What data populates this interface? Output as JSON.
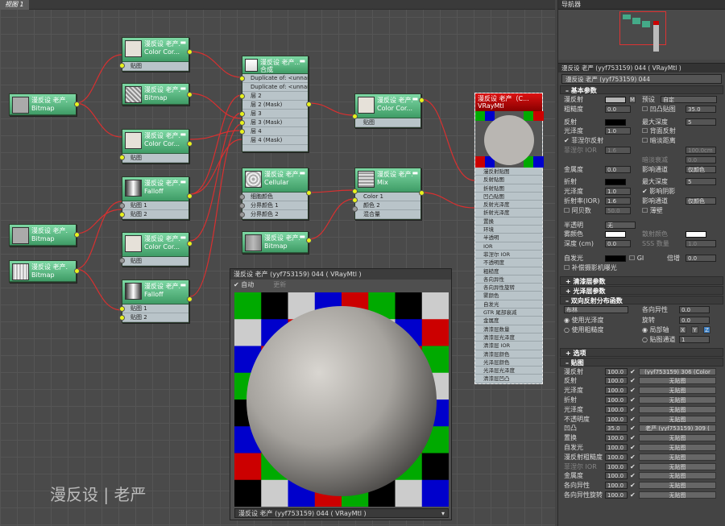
{
  "view_tab": "视图 1",
  "nodes": {
    "bitmap_a": {
      "title": "漫反设 老产...",
      "sub": "Bitmap"
    },
    "cc1": {
      "title": "漫反设 老产...",
      "sub": "Color Cor...",
      "row": "贴图"
    },
    "bmp2": {
      "title": "漫反设 老产...",
      "sub": "Bitmap"
    },
    "cc2": {
      "title": "漫反设 老产...",
      "sub": "Color Cor...",
      "row": "贴图"
    },
    "falloff1": {
      "title": "漫反设 老产...",
      "sub": "Falloff",
      "rows": [
        "贴图 1",
        "贴图 2"
      ]
    },
    "bitmap_b": {
      "title": "漫反设 老产...",
      "sub": "Bitmap"
    },
    "cc3": {
      "title": "漫反设 老产...",
      "sub": "Color Cor...",
      "row": "贴图"
    },
    "bitmap_c": {
      "title": "漫反设 老产...",
      "sub": "Bitmap"
    },
    "falloff2": {
      "title": "漫反设 老产...",
      "sub": "Falloff",
      "rows": [
        "贴图 1",
        "贴图 2"
      ]
    },
    "composite": {
      "title": "漫反设 老产...",
      "sub": "合成",
      "rows": [
        "Duplicate of: <unnamed l...",
        "Duplicate of: <unnamed l...",
        "层 2",
        "层 2 (Mask)",
        "层 3",
        "层 3 (Mask)",
        "层 4",
        "层 4 (Mask)"
      ]
    },
    "cc4": {
      "title": "漫反设 老产...",
      "sub": "Color Cor...",
      "row": "贴图"
    },
    "cellular": {
      "title": "漫反设 老产...",
      "sub": "Cellular",
      "rows": [
        "细胞颜色",
        "分界颜色 1",
        "分界颜色 2"
      ]
    },
    "bitmap_d": {
      "title": "漫反设 老产...",
      "sub": "Bitmap"
    },
    "mix": {
      "title": "漫反设 老产...",
      "sub": "Mix",
      "rows": [
        "Color 1",
        "颜色 2",
        "混合量"
      ]
    }
  },
  "vray": {
    "title": "漫反设 老产（C...",
    "sub": "VRayMtl",
    "rows": [
      "漫反射贴图",
      "反射贴图",
      "折射贴图",
      "凹凸贴图",
      "反射光泽度",
      "折射光泽度",
      "置换",
      "环境",
      "半透明",
      "IOR",
      "菲涅尔 IOR",
      "不透明度",
      "粗糙度",
      "各向异性",
      "各向异性旋转",
      "雾颜色",
      "自发光",
      "GTR 尾部衰减",
      "金属度",
      "清漆层数量",
      "清漆层光泽度",
      "清漆层 IOR",
      "清漆层颜色",
      "光泽层颜色",
      "光泽层光泽度",
      "清漆层凹凸"
    ]
  },
  "preview": {
    "title": "漫反设 老产 (yyf753159) 044 ( VRayMtl )",
    "auto": "自动",
    "update": "更新",
    "footer": "漫反设 老产 (yyf753159) 044   ( VRayMtl )"
  },
  "watermark": "漫反设 | 老严",
  "panel": {
    "nav_title": "导航器",
    "mat_title": "漫反设 老严 (yyf753159) 044 ( VRayMtl )",
    "mat_name": "漫反设 老严 (yyf753159) 044",
    "basic": "基本参数",
    "diffuse": "漫反射",
    "m": "M",
    "preset": "预设",
    "preset_val": "自定",
    "roughness": "粗糙度",
    "roughness_v": "0.0",
    "bump_map": "凹凸贴图",
    "bump_v": "35.0",
    "reflect": "反射",
    "max_depth": "最大深度",
    "max_depth_v": "5",
    "gloss": "光泽度",
    "gloss_v": "1.0",
    "back_reflect": "背面反射",
    "fresnel": "菲涅尔反射",
    "dim_dist": "暗淡距离",
    "dim_dist_v": "100.0cm",
    "fresnel_ior": "菲涅尔 IOR",
    "fresnel_ior_v": "1.6",
    "dim_fall": "暗淡衰减",
    "dim_fall_v": "0.0",
    "metal": "金属度",
    "metal_v": "0.0",
    "affect_ch": "影响通道",
    "affect_ch_v": "仅颜色",
    "refract": "折射",
    "r_max_depth": "最大深度",
    "r_max_depth_v": "5",
    "r_gloss": "光泽度",
    "r_gloss_v": "1.0",
    "shadow": "影响阴影",
    "ior": "折射率(IOR)",
    "ior_v": "1.6",
    "r_affect": "影响通道",
    "r_affect_v": "仅颜色",
    "abbe": "阿贝数",
    "abbe_v": "50.0",
    "thin": "薄壁",
    "translucency": "半透明",
    "translucency_v": "无",
    "fog": "雾颜色",
    "scatter": "散射颜色",
    "depth": "深度 (cm)",
    "depth_v": "0.0",
    "sss": "SSS 数量",
    "sss_v": "1.0",
    "self_illum": "自发光",
    "gi": "GI",
    "mult": "倍增",
    "mult_v": "0.0",
    "compensate": "补偿摄影机曝光",
    "coat": "清漆层参数",
    "sheen": "光泽层参数",
    "brdf": "双向反射分布函数",
    "brdf_type": "布林",
    "aniso": "各向异性",
    "aniso_v": "0.0",
    "use_gloss": "使用光泽度",
    "rotation": "旋转",
    "rotation_v": "0.0",
    "use_rough": "使用粗糙度",
    "local_axis": "局部轴",
    "x": "X",
    "y": "Y",
    "z": "Z",
    "map_ch": "贴图通道",
    "map_ch_v": "1",
    "options": "选项",
    "maps": "贴图",
    "map_rows": [
      {
        "name": "漫反射",
        "val": "100.0",
        "map": "(yyf753159) 306  (Color"
      },
      {
        "name": "反射",
        "val": "100.0",
        "map": "无贴图"
      },
      {
        "name": "光泽度",
        "val": "100.0",
        "map": "无贴图"
      },
      {
        "name": "折射",
        "val": "100.0",
        "map": "无贴图"
      },
      {
        "name": "光泽度",
        "val": "100.0",
        "map": "无贴图"
      },
      {
        "name": "不透明度",
        "val": "100.0",
        "map": "无贴图"
      },
      {
        "name": "凹凸",
        "val": "35.0",
        "map": "老严 (yyf753159) 309  ("
      },
      {
        "name": "置换",
        "val": "100.0",
        "map": "无贴图"
      },
      {
        "name": "自发光",
        "val": "100.0",
        "map": "无贴图"
      },
      {
        "name": "漫反射粗糙度",
        "val": "100.0",
        "map": "无贴图"
      },
      {
        "name": "菲涅尔 IOR",
        "val": "100.0",
        "map": "无贴图"
      },
      {
        "name": "金属度",
        "val": "100.0",
        "map": "无贴图"
      },
      {
        "name": "各向异性",
        "val": "100.0",
        "map": "无贴图"
      },
      {
        "name": "各向异性旋转",
        "val": "100.0",
        "map": "无贴图"
      }
    ]
  }
}
